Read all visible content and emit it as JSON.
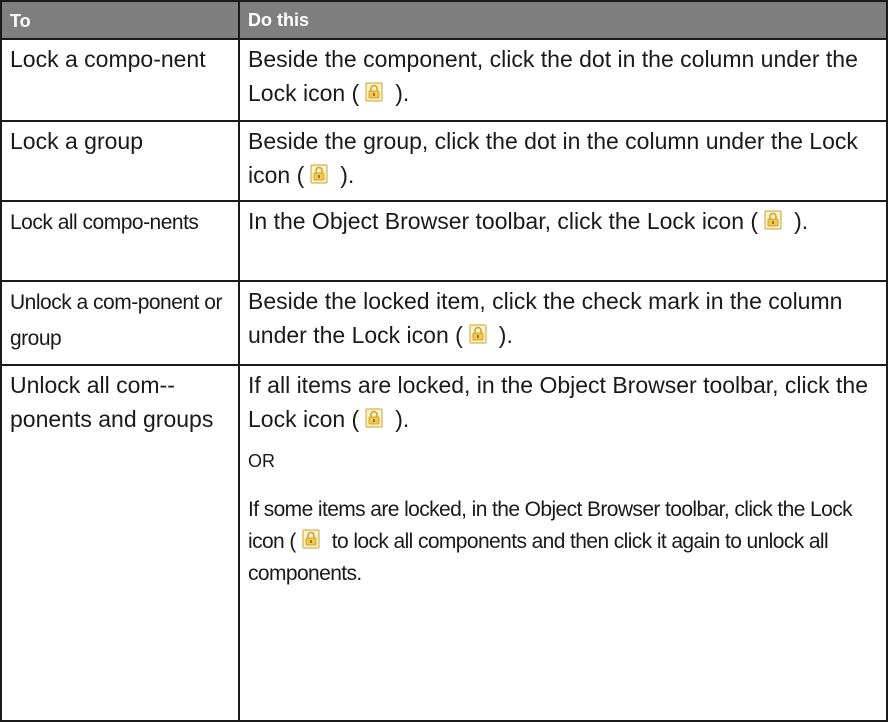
{
  "header": {
    "col1": "To",
    "col2": "Do this"
  },
  "rows": [
    {
      "to": "Lock a compo-­nent",
      "do_a": "Beside the component, click the dot in the column under the Lock icon (",
      "do_b": ")."
    },
    {
      "to": "Lock a group",
      "do_a": "Beside the group, click the dot in the column under the Lock icon (",
      "do_b": ")."
    },
    {
      "to": "Lock all compo-­nents",
      "do_a": "In the Object Browser toolbar, click the Lock icon (",
      "do_b": ")."
    },
    {
      "to": "Unlock a com-­ponent or group",
      "do_a": "Beside the locked item, click the check mark in the column under the Lock icon (",
      "do_b": ")."
    },
    {
      "to": "Unlock all com-­ponents and groups",
      "p1_a": "If all items are locked, in the Object Browser toolbar, click the Lock icon (",
      "p1_b": ").",
      "or": "OR",
      "p2_a": "If some items are locked, in the Object Browser toolbar, click the Lock icon (",
      "p2_b": "to lock all components and then click it again to unlock all components."
    }
  ],
  "icon": "lock-icon",
  "colors": {
    "header_bg": "#7f7f7f",
    "header_text": "#ffffff",
    "border": "#1a1a1a",
    "lock_body": "#f2c94c",
    "lock_shackle": "#c8a23a"
  }
}
